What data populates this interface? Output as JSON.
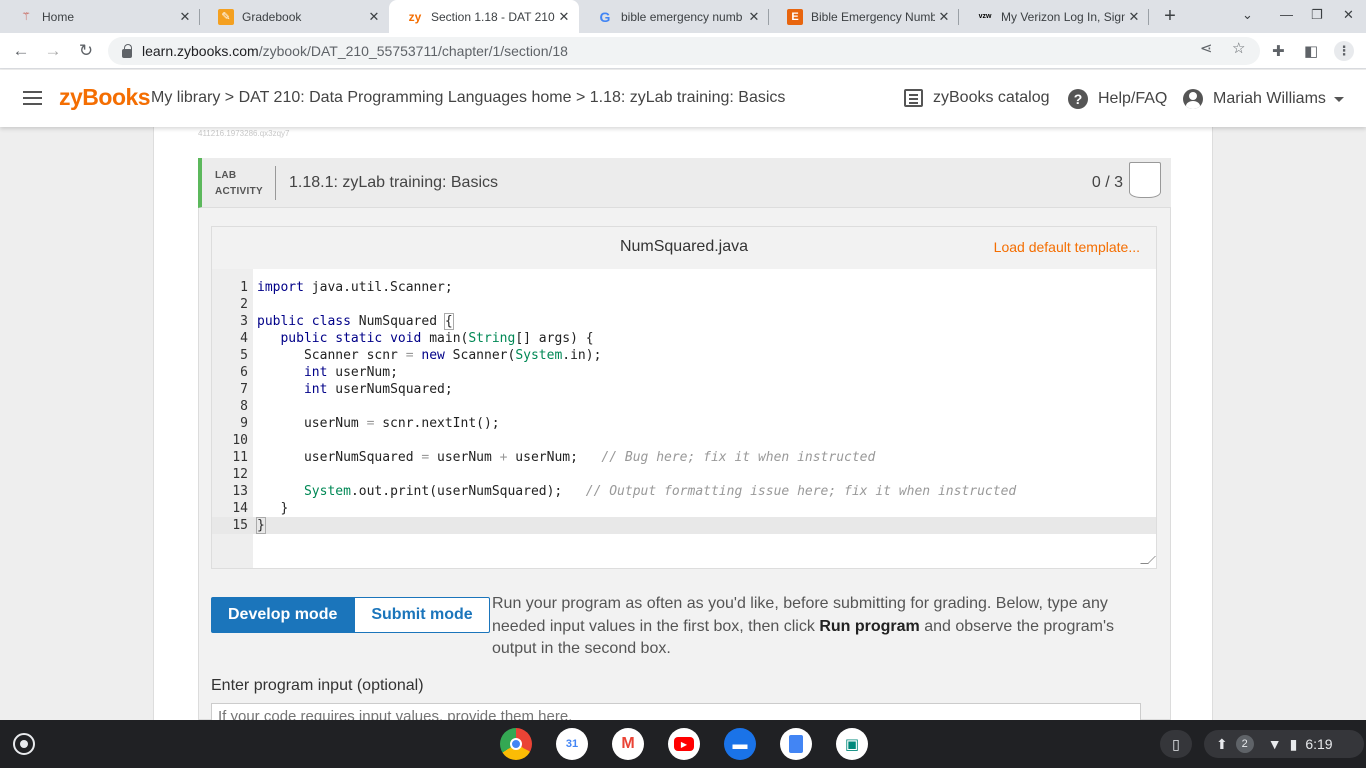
{
  "browser": {
    "tabs": [
      {
        "title": "Home",
        "active": false
      },
      {
        "title": "Gradebook",
        "active": false
      },
      {
        "title": "Section 1.18 - DAT 210",
        "active": true
      },
      {
        "title": "bible emergency numb",
        "active": false
      },
      {
        "title": "Bible Emergency Numb",
        "active": false
      },
      {
        "title": "My Verizon Log In, Sign",
        "active": false
      }
    ],
    "url_host": "learn.zybooks.com",
    "url_path": "/zybook/DAT_210_55753711/chapter/1/section/18"
  },
  "header": {
    "logo": "zyBooks",
    "breadcrumb": "My library > DAT 210: Data Programming Languages home > 1.18: zyLab training: Basics",
    "catalog": "zyBooks catalog",
    "help": "Help/FAQ",
    "user": "Mariah Williams"
  },
  "page": {
    "tiny_id": "411216.1973286.qx3zqy7"
  },
  "activity": {
    "label_line1": "LAB",
    "label_line2": "ACTIVITY",
    "title": "1.18.1: zyLab training: Basics",
    "score": "0 / 3"
  },
  "editor": {
    "filename": "NumSquared.java",
    "load_default": "Load default template...",
    "line_numbers": [
      "1",
      "2",
      "3",
      "4",
      "5",
      "6",
      "7",
      "8",
      "9",
      "10",
      "11",
      "12",
      "13",
      "14",
      "15"
    ],
    "lines": [
      "import java.util.Scanner;",
      "",
      "public class NumSquared {",
      "   public static void main(String[] args) {",
      "      Scanner scnr = new Scanner(System.in);",
      "      int userNum;",
      "      int userNumSquared;",
      "",
      "      userNum = scnr.nextInt();",
      "",
      "      userNumSquared = userNum + userNum;   // Bug here; fix it when instructed",
      "",
      "      System.out.print(userNumSquared);   // Output formatting issue here; fix it when instructed",
      "   }",
      "}"
    ]
  },
  "modes": {
    "develop": "Develop mode",
    "submit": "Submit mode",
    "description_before": "Run your program as often as you'd like, before submitting for grading. Below, type any needed input values in the first box, then click ",
    "description_bold": "Run program",
    "description_after": " and observe the program's output in the second box."
  },
  "input": {
    "label": "Enter program input (optional)",
    "placeholder": "If your code requires input values, provide them here."
  },
  "shelf": {
    "calendar_day": "31",
    "notification_count": "2",
    "time": "6:19"
  },
  "colors": {
    "zy_orange": "#f46e02",
    "zy_blue": "#1b75bb",
    "lab_green": "#5cb85c"
  }
}
